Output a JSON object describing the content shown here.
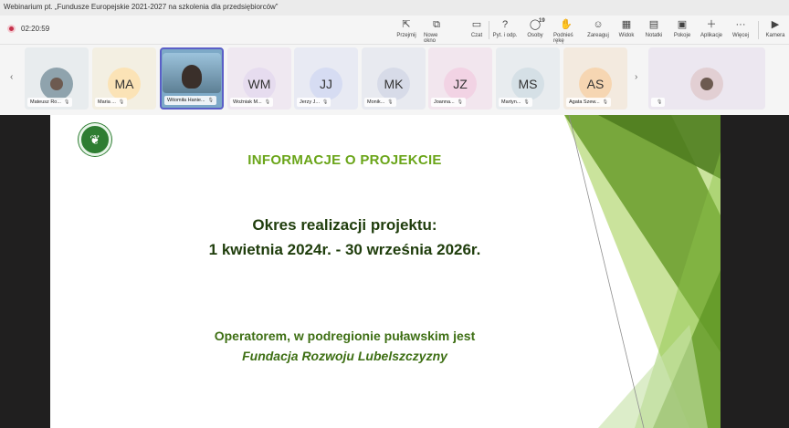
{
  "window": {
    "title": "Webinarium pt. „Fundusze Europejskie 2021-2027 na szkolenia dla przedsiębiorców”"
  },
  "meeting": {
    "recording_time": "02:20:59",
    "participant_count": "19"
  },
  "toolbar": {
    "items": [
      {
        "label": "Przejmij",
        "icon": "take-control-icon"
      },
      {
        "label": "Nowe okno",
        "icon": "new-window-icon"
      },
      {
        "label": "Czat",
        "icon": "chat-icon"
      },
      {
        "label": "Pyt. i odp.",
        "icon": "qa-icon"
      },
      {
        "label": "Osoby",
        "icon": "people-icon"
      },
      {
        "label": "Podnieś rękę",
        "icon": "raise-hand-icon"
      },
      {
        "label": "Zareaguj",
        "icon": "react-icon"
      },
      {
        "label": "Widok",
        "icon": "view-icon"
      },
      {
        "label": "Notatki",
        "icon": "notes-icon"
      },
      {
        "label": "Pokoje",
        "icon": "rooms-icon"
      },
      {
        "label": "Aplikacje",
        "icon": "apps-icon"
      },
      {
        "label": "Więcej",
        "icon": "more-icon"
      },
      {
        "label": "Kamera",
        "icon": "camera-icon"
      }
    ]
  },
  "participants": [
    {
      "name": "Mateusz Ro...",
      "initials": "",
      "bg": "#e8ecee",
      "avatar_bg": "#8fa3ad",
      "photo": true
    },
    {
      "name": "Maria ...",
      "initials": "MA",
      "bg": "#f3efe2",
      "avatar_bg": "#fbe3b6"
    },
    {
      "name": "Witomiła Hanie...",
      "initials": "",
      "bg": "#7da9c7",
      "avatar_bg": "#3c4f5c",
      "photo": true,
      "active": true
    },
    {
      "name": "Woźniak M...",
      "initials": "WM",
      "bg": "#efe8f1",
      "avatar_bg": "#e6dcef"
    },
    {
      "name": "Jerzy J...",
      "initials": "JJ",
      "bg": "#e8eaf3",
      "avatar_bg": "#d6dcf2"
    },
    {
      "name": "Monik...",
      "initials": "MK",
      "bg": "#e8eaf0",
      "avatar_bg": "#d7dbe8"
    },
    {
      "name": "Joanna...",
      "initials": "JZ",
      "bg": "#f2e6ee",
      "avatar_bg": "#f2d3e4"
    },
    {
      "name": "Martyn...",
      "initials": "MS",
      "bg": "#e8ecef",
      "avatar_bg": "#d5e0e6"
    },
    {
      "name": "Agata Szew...",
      "initials": "AS",
      "bg": "#f3eadf",
      "avatar_bg": "#f6d6b2"
    },
    {
      "name": "",
      "initials": "",
      "bg": "#ece7f0",
      "avatar_bg": "#e2cfd3",
      "photo": true
    }
  ],
  "slide": {
    "heading": "INFORMACJE O PROJEKCIE",
    "period_label": "Okres realizacji projektu:",
    "period_value": "1 kwietnia 2024r. - 30 września 2026r.",
    "operator_line": "Operatorem, w podregionie puławskim jest",
    "operator_name": "Fundacja Rozwoju Lubelszczyzny",
    "accent_color": "#6aa519"
  }
}
